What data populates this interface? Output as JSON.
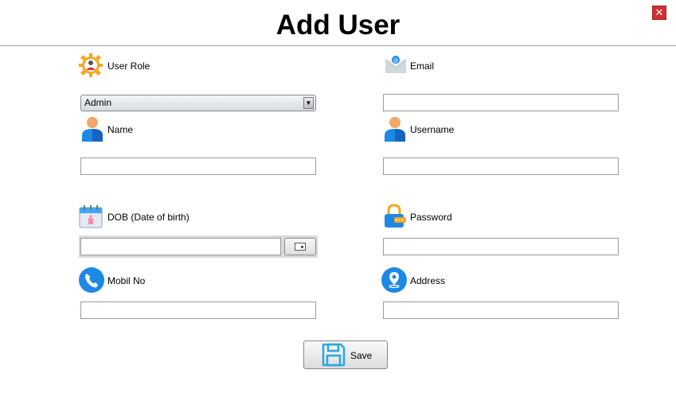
{
  "window": {
    "title": "Add User",
    "close_label": "✕"
  },
  "form": {
    "user_role": {
      "label": "User Role",
      "icon": "user-gear-icon",
      "selected": "Admin"
    },
    "email": {
      "label": "Email",
      "icon": "email-icon",
      "value": ""
    },
    "name": {
      "label": "Name",
      "icon": "person-icon",
      "value": ""
    },
    "username": {
      "label": "Username",
      "icon": "person-icon",
      "value": ""
    },
    "dob": {
      "label": "DOB (Date of birth)",
      "icon": "calendar-icon",
      "value": ""
    },
    "password": {
      "label": "Password",
      "icon": "lock-icon",
      "value": ""
    },
    "mobile": {
      "label": "Mobil No",
      "icon": "phone-icon",
      "value": ""
    },
    "address": {
      "label": "Address",
      "icon": "location-pin-icon",
      "value": ""
    }
  },
  "actions": {
    "save_label": "Save",
    "save_icon": "floppy-disk-icon"
  },
  "colors": {
    "close": "#d32f2f",
    "icon_blue": "#1e88e5",
    "icon_orange": "#f5a623"
  }
}
